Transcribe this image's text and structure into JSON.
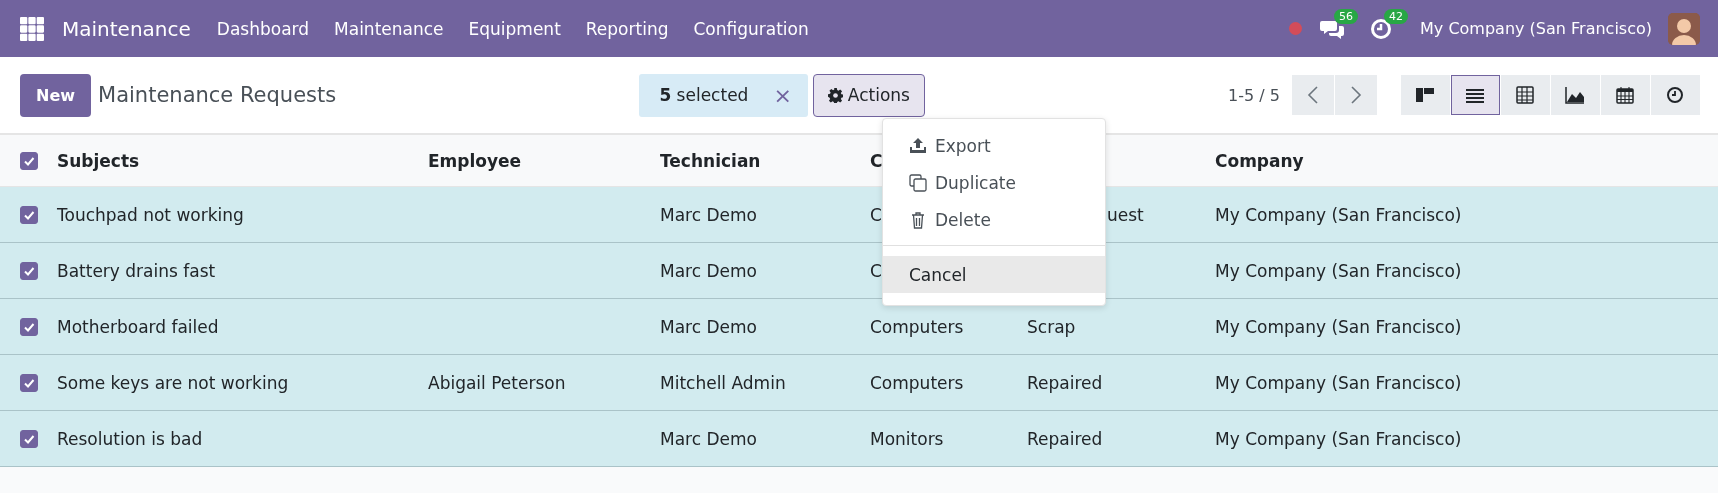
{
  "navbar": {
    "app_name": "Maintenance",
    "menu": [
      {
        "label": "Dashboard"
      },
      {
        "label": "Maintenance"
      },
      {
        "label": "Equipment"
      },
      {
        "label": "Reporting"
      },
      {
        "label": "Configuration"
      }
    ],
    "messages_badge": "56",
    "activities_badge": "42",
    "company": "My Company (San Francisco)"
  },
  "control_panel": {
    "new_button": "New",
    "title": "Maintenance Requests",
    "selection": "**5** selected",
    "clear": "×",
    "actions": "Actions",
    "pager": "1-5 / 5",
    "views": [
      {
        "kind": "kanban",
        "selected": false
      },
      {
        "kind": "list",
        "selected": true
      },
      {
        "kind": "pivot",
        "selected": false
      },
      {
        "kind": "graph",
        "selected": false
      },
      {
        "kind": "calendar",
        "selected": false
      },
      {
        "kind": "activity",
        "selected": false
      }
    ]
  },
  "actions_menu": {
    "items": [
      {
        "kind": "export",
        "label": "Export"
      },
      {
        "kind": "duplicate",
        "label": "Duplicate"
      },
      {
        "kind": "delete",
        "label": "Delete"
      }
    ],
    "cancel": {
      "label": "Cancel",
      "hovered": true
    }
  },
  "table": {
    "all_checked": true,
    "header": {
      "subjects": "Subjects",
      "employee": "Employee",
      "technician": "Technician",
      "column_4": "C",
      "company": "Company"
    },
    "rows": [
      {
        "selected": true,
        "subjects": "Touchpad not working",
        "technician": "Marc Demo",
        "column_4": {
          "text": "C"
        },
        "column_5": {
          "text": "uest",
          "covered_left": true
        },
        "company": "My Company (San Francisco)"
      },
      {
        "selected": true,
        "subjects": "Battery drains fast",
        "technician": "Marc Demo",
        "column_4": {
          "text": "C"
        },
        "company": "My Company (San Francisco)"
      },
      {
        "selected": true,
        "subjects": "Motherboard failed",
        "technician": "Marc Demo",
        "column_4": {
          "text": "Computers"
        },
        "column_5": {
          "text": "Scrap"
        },
        "company": "My Company (San Francisco)"
      },
      {
        "selected": true,
        "subjects": "Some keys are not working",
        "employee": "Abigail Peterson",
        "technician": "Mitchell Admin",
        "column_4": {
          "text": "Computers"
        },
        "column_5": {
          "text": "Repaired"
        },
        "company": "My Company (San Francisco)"
      },
      {
        "selected": true,
        "subjects": "Resolution is bad",
        "technician": "Marc Demo",
        "column_4": {
          "text": "Monitors"
        },
        "column_5": {
          "text": "Repaired"
        },
        "company": "My Company (San Francisco)"
      }
    ]
  }
}
